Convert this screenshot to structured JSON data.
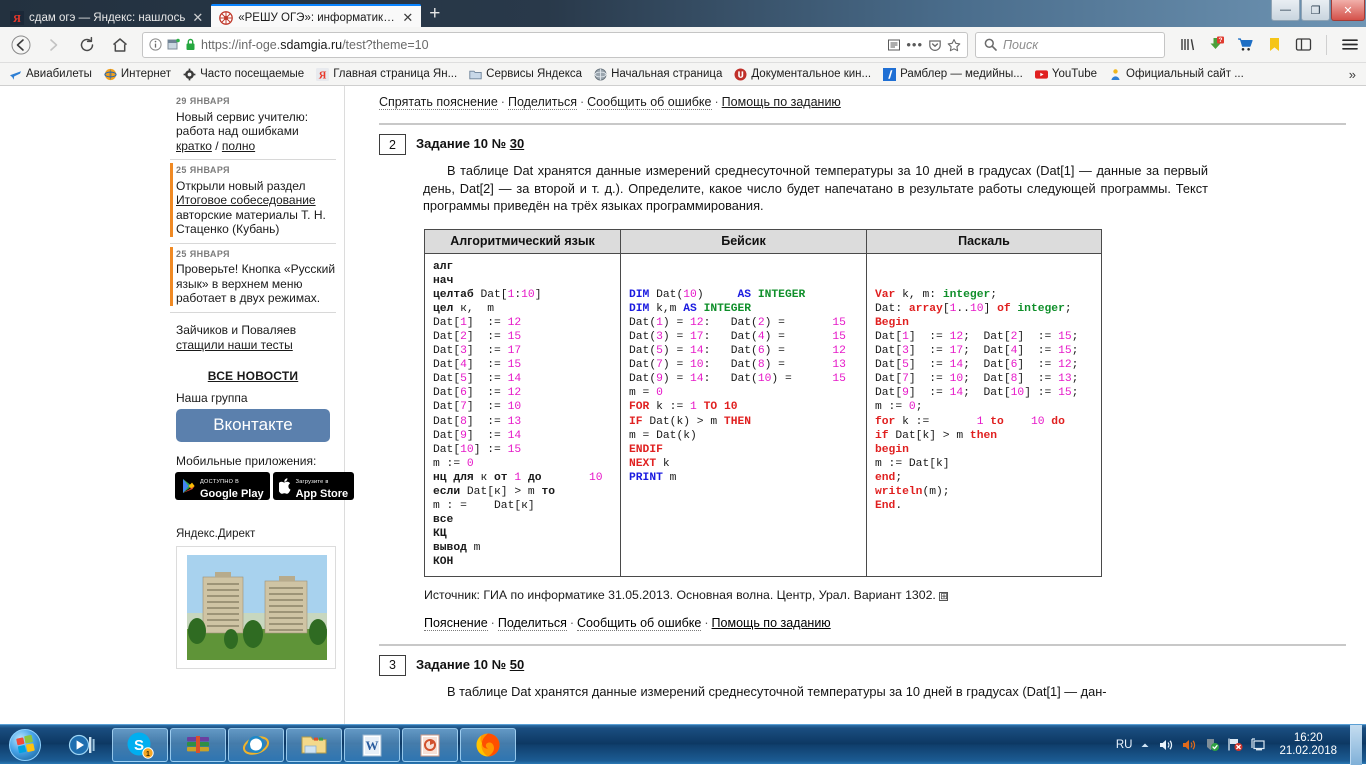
{
  "browser": {
    "tabs": [
      {
        "title": "сдам огэ — Яндекс: нашлось",
        "active": false,
        "favicon": "yandex-icon"
      },
      {
        "title": "«РЕШУ ОГЭ»: информатика. О",
        "active": true,
        "favicon": "sdamgia-icon"
      }
    ],
    "new_tab_label": "+",
    "close_glyph": "✕",
    "window_controls": {
      "minimize": "—",
      "maximize": "❐",
      "close": "✕"
    },
    "nav": {
      "back": "←",
      "forward": "→",
      "reload": "⟳",
      "home": "⌂"
    },
    "url": {
      "prefix": "https://inf-oge.",
      "domain": "sdamgia.ru",
      "path": "/test?theme=10"
    },
    "search_placeholder": "Поиск",
    "toolbar_icons": [
      "library-icon",
      "downloads-icon",
      "shopping-cart-icon",
      "bookmark-icon",
      "sidebar-icon",
      "menu-icon"
    ],
    "downloads_badge": "?",
    "bookmarks": [
      {
        "label": "Авиабилеты",
        "icon": "plane-icon"
      },
      {
        "label": "Интернет",
        "icon": "globe-icon"
      },
      {
        "label": "Часто посещаемые",
        "icon": "gear-icon"
      },
      {
        "label": "Главная страница Ян...",
        "icon": "yandex-icon"
      },
      {
        "label": "Сервисы Яндекса",
        "icon": "folder-icon"
      },
      {
        "label": "Начальная страница",
        "icon": "globe-gray-icon"
      },
      {
        "label": "Документальное кин...",
        "icon": "red-circle-icon"
      },
      {
        "label": "Рамблер — медийны...",
        "icon": "rambler-icon"
      },
      {
        "label": "YouTube",
        "icon": "youtube-icon"
      },
      {
        "label": "Официальный сайт ...",
        "icon": "person-icon"
      }
    ],
    "bookmarks_overflow": "»"
  },
  "sidebar": {
    "news": [
      {
        "date": "29 ЯНВАРЯ",
        "text": "Новый сервис учителю: работа над ошибками",
        "links": [
          "кратко",
          "полно"
        ],
        "link_sep": " / ",
        "accent": false
      },
      {
        "date": "25 ЯНВАРЯ",
        "text_before": "Открыли новый раздел ",
        "link": "Итоговое собеседование",
        "text_after": " авторские материалы Т. Н. Стаценко (Кубань)",
        "accent": true
      },
      {
        "date": "25 ЯНВАРЯ",
        "text": "Проверьте! Кнопка «Русский язык» в верхнем меню работает в двух режимах.",
        "accent": true
      }
    ],
    "stolen_tests": {
      "text": "Зайчиков и Поваляев ",
      "link": "стащили наши тесты"
    },
    "all_news": "ВСЕ НОВОСТИ",
    "group_label": "Наша группа",
    "vk_button": "Вконтакте",
    "apps_label": "Мобильные приложения:",
    "app_badges": [
      {
        "top": "ДОСТУПНО В",
        "bottom": "Google Play",
        "icon": "google-play-icon"
      },
      {
        "top": "Загрузите в",
        "bottom": "App Store",
        "icon": "apple-icon"
      }
    ],
    "direct_label": "Яндекс.Директ",
    "direct_image": "apartment-buildings-photo"
  },
  "content": {
    "toolbar_top": {
      "hide_explanation": "Спрятать пояснение",
      "share": "Поделиться",
      "report_error": "Сообщить об ошибке",
      "help": "Помощь по заданию",
      "separator": "·"
    },
    "task": {
      "number": "2",
      "title_prefix": "Задание 10 № ",
      "title_id": "30",
      "body": "В таблице Dat хранятся данные измерений среднесуточной температуры за 10 дней в градусах (Dat[1] — дан­ные за первый день, Dat[2] — за второй и т. д.). Определите, какое число будет напечатано в результате работы следующей программы. Текст программы приведён на трёх языках программирования."
    },
    "code_table": {
      "headers": [
        "Алгоритмический язык",
        "Бейсик",
        "Паскаль"
      ],
      "alg_lines": [
        "алг",
        "нач",
        "целтаб Dat[1:10]",
        "цел к,  m",
        "Dat[1]  := 12",
        "Dat[2]  := 15",
        "Dat[3]  := 17",
        "Dat[4]  := 15",
        "Dat[5]  := 14",
        "Dat[6]  := 12",
        "Dat[7]  := 10",
        "Dat[8]  := 13",
        "Dat[9]  := 14",
        "Dat[10] := 15",
        "m := 0",
        "нц для к от 1 до        10",
        "если Dat[к] > m то",
        "m : =    Dat[к]",
        "все",
        "КЦ",
        "вывод m",
        "КОН"
      ],
      "basic_lines": [
        "DIM Dat(10)     AS INTEGER",
        "DIM k,m AS INTEGER",
        "Dat(1) = 12:   Dat(2) =        15",
        "Dat(3) = 17:   Dat(4) =        15",
        "Dat(5) = 14:   Dat(6) =        12",
        "Dat(7) = 10:   Dat(8) =        13",
        "Dat(9) = 14:   Dat(10) =       15",
        "m = 0",
        "FOR k := 1 TO 10",
        "IF Dat(k) > m THEN",
        "m = Dat(k)",
        "ENDIF",
        "NEXT k",
        "PRINT m"
      ],
      "pascal_lines": [
        "Var k, m: integer;",
        "Dat: array[1..10] of integer;",
        "Begin",
        "Dat[1]  := 12;  Dat[2]  := 15;",
        "Dat[3]  := 17;  Dat[4]  := 15;",
        "Dat[5]  := 14;  Dat[6]  := 12;",
        "Dat[7]  := 10;  Dat[8]  := 13;",
        "Dat[9]  := 14;  Dat[10] := 15;",
        "m := 0;",
        "for k :=        1 to    10 do",
        "if Dat[k] > m then",
        "begin",
        "m := Dat[k]",
        "end;",
        "writeln(m);",
        "End."
      ]
    },
    "source": "Источник: ГИА по информатике 31.05.2013. Основная волна. Центр, Урал. Вариант 1302.",
    "source_expand": "⊞",
    "toolbar_bottom": {
      "explanation": "Пояснение",
      "share": "Поделиться",
      "report_error": "Сообщить об ошибке",
      "help": "Помощь по заданию",
      "separator": "·"
    },
    "next_task": {
      "number": "3",
      "title_prefix": "Задание 10 № ",
      "title_id": "50",
      "body": "В таблице Dat хранятся данные измерений среднесуточной температуры за 10 дней в градусах (Dat[1] — дан-"
    }
  },
  "taskbar": {
    "start_label": "start-orb",
    "items": [
      {
        "name": "media-player-icon",
        "running": false
      },
      {
        "name": "skype-icon",
        "running": true,
        "badge": "1"
      },
      {
        "name": "winrar-icon",
        "running": true
      },
      {
        "name": "internet-explorer-icon",
        "running": true
      },
      {
        "name": "explorer-folder-icon",
        "running": true
      },
      {
        "name": "word-icon",
        "running": true
      },
      {
        "name": "powerpoint-icon",
        "running": true
      },
      {
        "name": "firefox-icon",
        "running": true
      }
    ],
    "language": "RU",
    "tray_icons": [
      "arrow-up-icon",
      "volume-icon",
      "speaker-icon",
      "security-shield-icon",
      "network-flag-icon",
      "display-icon"
    ],
    "time": "16:20",
    "date": "21.02.2018"
  },
  "colors": {
    "accent_blue": "#0a84ff",
    "number_magenta": "#e618c8",
    "keyword_red": "#e02020",
    "keyword_blue": "#1a1ae0",
    "type_green": "#0f8f2a",
    "news_accent": "#f08a24",
    "vk_blue": "#5b80ad"
  }
}
